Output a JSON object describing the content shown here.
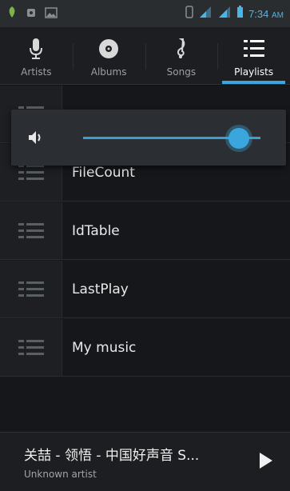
{
  "status_bar": {
    "time": "7:34",
    "ampm": "AM",
    "icons": [
      "battery-saver-icon",
      "notification-icon",
      "image-icon",
      "sim-icon",
      "signal-icon",
      "signal-icon-2",
      "battery-icon"
    ],
    "time_color": "#47b7e9"
  },
  "tabs": [
    {
      "label": "Artists",
      "icon": "microphone-icon"
    },
    {
      "label": "Albums",
      "icon": "disc-icon"
    },
    {
      "label": "Songs",
      "icon": "music-note-icon"
    },
    {
      "label": "Playlists",
      "icon": "list-icon"
    }
  ],
  "playlists": [
    {
      "name": ""
    },
    {
      "name": "FileCount"
    },
    {
      "name": "IdTable"
    },
    {
      "name": "LastPlay"
    },
    {
      "name": "My music"
    }
  ],
  "volume": {
    "icon": "speaker-icon",
    "level": 0.9
  },
  "now_playing": {
    "title": "关喆 - 领悟 - 中国好声音 S...",
    "artist": "Unknown artist",
    "play_icon": "play-icon"
  },
  "colors": {
    "accent": "#3aa6dd",
    "background": "#15171a"
  }
}
